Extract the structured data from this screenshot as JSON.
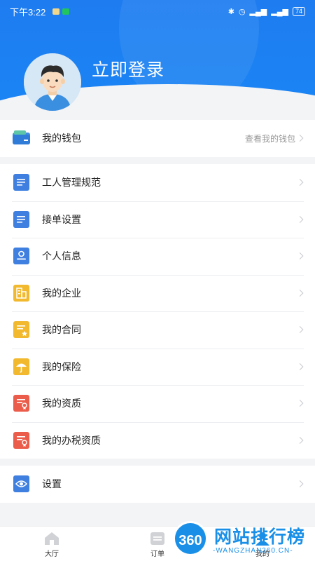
{
  "status_bar": {
    "time": "下午3:22",
    "battery": "74"
  },
  "profile": {
    "login_label": "立即登录"
  },
  "wallet": {
    "label": "我的钱包",
    "hint": "查看我的钱包"
  },
  "menu": [
    {
      "label": "工人管理规范",
      "icon": "document-icon",
      "color": "#3f7fe0"
    },
    {
      "label": "接单设置",
      "icon": "document-icon",
      "color": "#3f7fe0"
    },
    {
      "label": "个人信息",
      "icon": "id-card-icon",
      "color": "#3f7fe0"
    },
    {
      "label": "我的企业",
      "icon": "building-icon",
      "color": "#f2b92f"
    },
    {
      "label": "我的合同",
      "icon": "contract-icon",
      "color": "#f2b92f"
    },
    {
      "label": "我的保险",
      "icon": "umbrella-icon",
      "color": "#f2b92f"
    },
    {
      "label": "我的资质",
      "icon": "certificate-icon",
      "color": "#ec5c4a"
    },
    {
      "label": "我的办税资质",
      "icon": "certificate-icon",
      "color": "#ec5c4a"
    }
  ],
  "settings": {
    "label": "设置",
    "icon": "eye-icon",
    "color": "#3f7fe0"
  },
  "tabbar": [
    {
      "label": "大厅",
      "icon": "house-icon"
    },
    {
      "label": "订单",
      "icon": "order-icon"
    },
    {
      "label": "我的",
      "icon": "user-icon"
    }
  ],
  "watermark": {
    "badge": "360",
    "title": "网站排行榜",
    "subtitle": "-WANGZHAN360.CN-"
  }
}
